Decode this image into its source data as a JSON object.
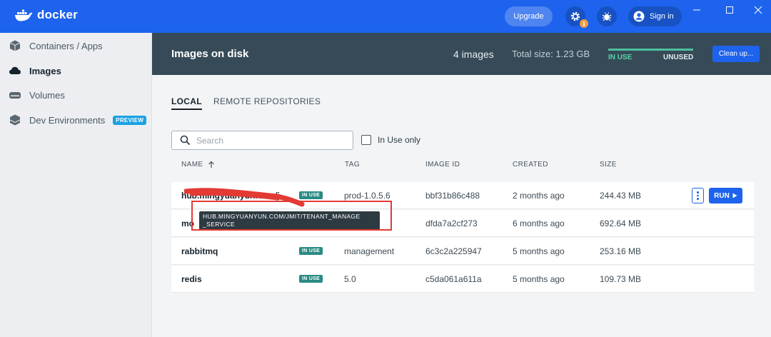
{
  "app": {
    "name": "docker"
  },
  "titlebar": {
    "upgrade_label": "Upgrade",
    "settings_badge": "1",
    "signin_label": "Sign in"
  },
  "sidebar": {
    "items": [
      {
        "label": "Containers / Apps",
        "icon": "container-icon"
      },
      {
        "label": "Images",
        "icon": "cloud-icon",
        "active": true
      },
      {
        "label": "Volumes",
        "icon": "volume-icon"
      },
      {
        "label": "Dev Environments",
        "icon": "dev-env-icon",
        "badge": "PREVIEW"
      }
    ]
  },
  "header": {
    "title": "Images on disk",
    "count": "4 images",
    "total_size": "Total size: 1.23 GB",
    "in_use_label": "IN USE",
    "unused_label": "UNUSED",
    "cleanup_label": "Clean up..."
  },
  "tabs": [
    {
      "label": "LOCAL",
      "active": true
    },
    {
      "label": "REMOTE REPOSITORIES"
    }
  ],
  "search": {
    "placeholder": "Search",
    "value": ""
  },
  "filter": {
    "in_use_only_label": "In Use only",
    "checked": false
  },
  "table": {
    "columns": [
      "NAME",
      "TAG",
      "IMAGE ID",
      "CREATED",
      "SIZE"
    ],
    "sort_column": "NAME",
    "rows": [
      {
        "name": "hub.mingyuanyun.com/j...",
        "badge": "IN USE",
        "tag": "prod-1.0.5.6",
        "image_id": "bbf31b86c488",
        "created": "2 months ago",
        "size": "244.43 MB",
        "hovered": true
      },
      {
        "name": "mo",
        "badge": "",
        "tag": "",
        "image_id": "dfda7a2cf273",
        "created": "6 months ago",
        "size": "692.64 MB"
      },
      {
        "name": "rabbitmq",
        "badge": "IN USE",
        "tag": "management",
        "image_id": "6c3c2a225947",
        "created": "5 months ago",
        "size": "253.16 MB"
      },
      {
        "name": "redis",
        "badge": "IN USE",
        "tag": "5.0",
        "image_id": "c5da061a611a",
        "created": "5 months ago",
        "size": "109.73 MB"
      }
    ],
    "run_label": "RUN"
  },
  "tooltip": {
    "line1": "HUB.MINGYUANYUN.COM/JMIT/TENANT_MANAGE",
    "line2": "_SERVICE"
  },
  "colors": {
    "brand": "#1D63ED",
    "header_bg": "#364B57",
    "in_use_badge": "#2A8A84",
    "annotation": "#E33A33"
  }
}
